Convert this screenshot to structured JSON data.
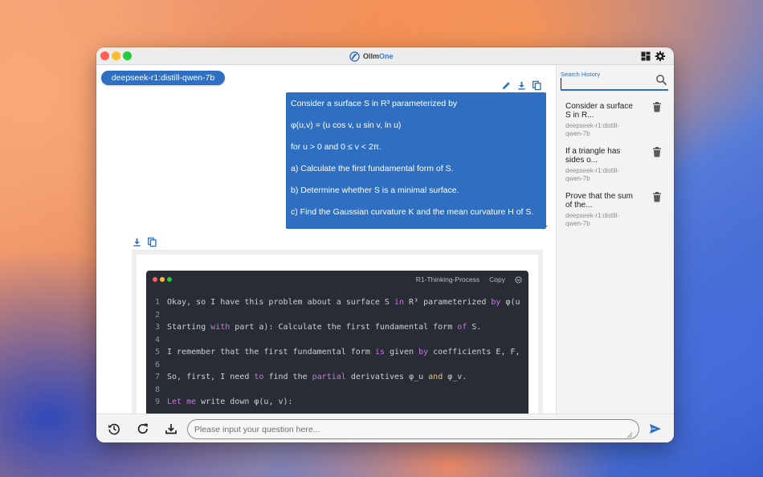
{
  "app": {
    "title_prefix": "Ollm",
    "title_suffix": "One"
  },
  "titlebar": {
    "icons": [
      "layout-grid-icon",
      "gear-icon"
    ]
  },
  "main": {
    "model_pill": "deepseek-r1:distill-qwen-7b",
    "user_message": {
      "lines": [
        "Consider a surface S in R³ parameterized by",
        "φ(u,v) = (u cos v, u sin v, ln u)",
        "for u > 0 and 0 ≤ v < 2π.",
        "a) Calculate the first fundamental form of S.",
        "b) Determine whether S is a minimal surface.",
        "c) Find the Gaussian curvature K and the mean curvature H of S."
      ],
      "tools": [
        "edit-icon",
        "download-icon",
        "copy-icon"
      ]
    },
    "assistant": {
      "tools": [
        "download-icon",
        "copy-icon"
      ],
      "code_block": {
        "language": "R1-Thinking-Process",
        "copy_label": "Copy",
        "lines": [
          {
            "n": "1",
            "text": "Okay, so I have this problem about a surface S in R³ parameterized by φ(u"
          },
          {
            "n": "2",
            "text": ""
          },
          {
            "n": "3",
            "text": "Starting with part a): Calculate the first fundamental form of S."
          },
          {
            "n": "4",
            "text": ""
          },
          {
            "n": "5",
            "text": "I remember that the first fundamental form is given by coefficients E, F,"
          },
          {
            "n": "6",
            "text": ""
          },
          {
            "n": "7",
            "text": "So, first, I need to find the partial derivatives φ_u and φ_v."
          },
          {
            "n": "8",
            "text": ""
          },
          {
            "n": "9",
            "text": "Let me write down φ(u, v):"
          }
        ]
      }
    }
  },
  "sidebar": {
    "search_label": "Search History",
    "search_value": "",
    "history": [
      {
        "title": "Consider a surface S in R...",
        "model": "deepseek-r1:distill-qwen-7b"
      },
      {
        "title": "If a triangle has sides o...",
        "model": "deepseek-r1:distill-qwen-7b"
      },
      {
        "title": "Prove that the sum of the...",
        "model": "deepseek-r1:distill-qwen-7b"
      }
    ]
  },
  "bottom": {
    "placeholder": "Please input your question here...",
    "icons": [
      "history-icon",
      "reload-icon",
      "download-icon",
      "send-icon"
    ]
  },
  "colors": {
    "accent": "#2f6fc1",
    "code_bg": "#282c34",
    "sidebar_bg": "#f3f3f4"
  }
}
